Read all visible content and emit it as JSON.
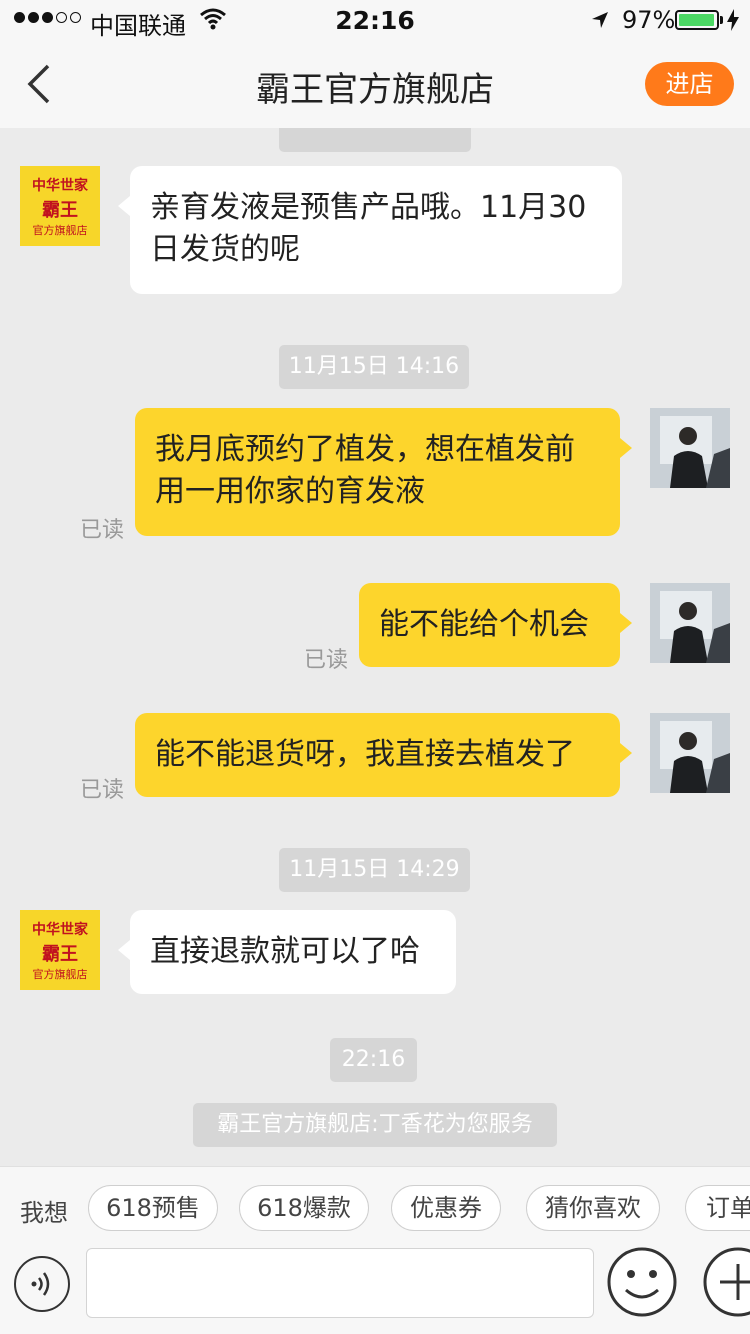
{
  "status_bar": {
    "carrier": "中国联通",
    "time": "22:16",
    "battery": "97%",
    "battery_level": 0.97,
    "signal_bars": 3
  },
  "header": {
    "title": "霸王官方旗舰店",
    "enter_button": "进店"
  },
  "messages": {
    "m1": {
      "text": "亲育发液是预售产品哦。11月30日发货的呢"
    },
    "ts1": "11月15日 14:16",
    "m2": {
      "text": "我月底预约了植发，想在植发前用一用你家的育发液",
      "status": "已读"
    },
    "m3": {
      "text": "能不能给个机会",
      "status": "已读"
    },
    "m4": {
      "text": "能不能退货呀，我直接去植发了",
      "status": "已读"
    },
    "ts2": "11月15日 14:29",
    "m5": {
      "text": "直接退款就可以了哈"
    },
    "ts3": "22:16",
    "notice": "霸王官方旗舰店:丁香花为您服务"
  },
  "quick_replies": {
    "label": "我想",
    "chips": [
      "618预售",
      "618爆款",
      "优惠券",
      "猜你喜欢",
      "订单"
    ]
  },
  "shop_logo": {
    "line1": "中华世家",
    "line2": "霸王",
    "line3": "官方旗舰店"
  },
  "colors": {
    "accent_orange": "#ff7a1a",
    "outgoing_bubble": "#fdd52c",
    "shop_logo_bg": "#f7d629",
    "shop_logo_text": "#c1121f"
  },
  "icons": [
    "back-icon",
    "wifi-icon",
    "location-arrow-icon",
    "battery-icon",
    "voice-icon",
    "emoji-icon",
    "plus-icon"
  ]
}
